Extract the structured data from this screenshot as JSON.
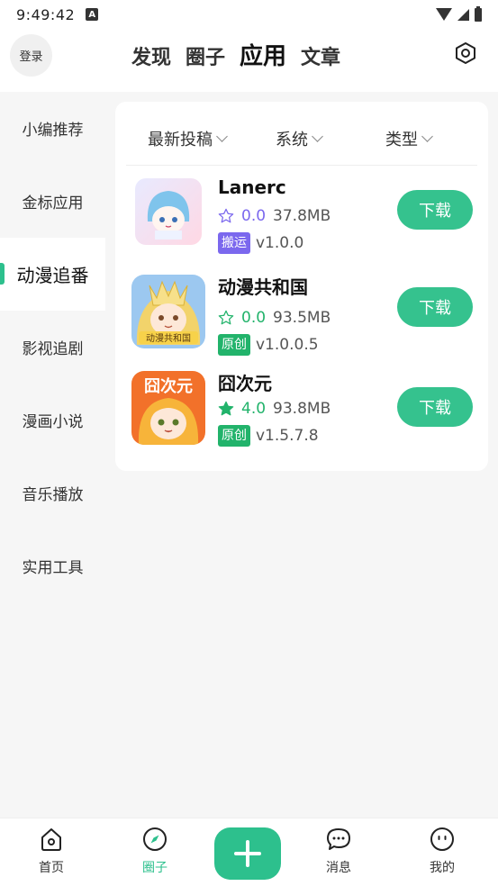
{
  "status_bar": {
    "time": "9:49:42",
    "notif_icon": "A"
  },
  "header": {
    "login": "登录",
    "tabs": [
      {
        "label": "发现",
        "active": false
      },
      {
        "label": "圈子",
        "active": false
      },
      {
        "label": "应用",
        "active": true
      },
      {
        "label": "文章",
        "active": false
      }
    ]
  },
  "sidebar": {
    "items": [
      {
        "label": "小编推荐",
        "active": false
      },
      {
        "label": "金标应用",
        "active": false
      },
      {
        "label": "动漫追番",
        "active": true
      },
      {
        "label": "影视追剧",
        "active": false
      },
      {
        "label": "漫画小说",
        "active": false
      },
      {
        "label": "音乐播放",
        "active": false
      },
      {
        "label": "实用工具",
        "active": false
      }
    ]
  },
  "filters": [
    "最新投稿",
    "系统",
    "类型"
  ],
  "apps": [
    {
      "name": "Lanerc",
      "rating": "0.0",
      "size": "37.8MB",
      "tag": "搬运",
      "tag_color": "#7b68ee",
      "rating_color": "#7b68ee",
      "starred": false,
      "version": "v1.0.0",
      "button": "下载"
    },
    {
      "name": "动漫共和国",
      "rating": "0.0",
      "size": "93.5MB",
      "tag": "原创",
      "tag_color": "#22b36b",
      "rating_color": "#22b36b",
      "starred": false,
      "version": "v1.0.0.5",
      "button": "下载"
    },
    {
      "name": "囧次元",
      "rating": "4.0",
      "size": "93.8MB",
      "tag": "原创",
      "tag_color": "#22b36b",
      "rating_color": "#22b36b",
      "starred": true,
      "version": "v1.5.7.8",
      "button": "下载",
      "icon_text": "囧次元"
    }
  ],
  "bottom_nav": {
    "items": [
      {
        "label": "首页",
        "icon": "home-icon",
        "active": false
      },
      {
        "label": "圈子",
        "icon": "compass-icon",
        "active": true
      },
      {
        "label": "消息",
        "icon": "chat-icon",
        "active": false
      },
      {
        "label": "我的",
        "icon": "face-icon",
        "active": false
      }
    ]
  },
  "colors": {
    "accent": "#2dc08d",
    "button": "#35c28e"
  }
}
